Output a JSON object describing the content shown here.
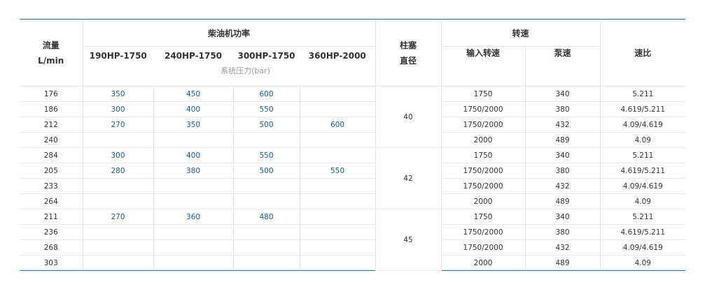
{
  "headers": {
    "flow_line1": "流量",
    "flow_line2": "L/min",
    "power_group": "柴油机功率",
    "power_cols": [
      "190HP-1750",
      "240HP-1750",
      "300HP-1750",
      "360HP-2000"
    ],
    "pressure_note": "系统压力(bar)",
    "plunger_line1": "柱塞",
    "plunger_line2": "直径",
    "speed_group": "转速",
    "input_speed": "输入转速",
    "pump_speed": "泵速",
    "ratio": "速比"
  },
  "rows": [
    {
      "flow": "176",
      "p1": "350",
      "p2": "450",
      "p3": "600",
      "p4": "",
      "input": "1750",
      "pump": "340",
      "ratio": "5.211"
    },
    {
      "flow": "186",
      "p1": "300",
      "p2": "400",
      "p3": "550",
      "p4": "",
      "input": "1750/2000",
      "pump": "380",
      "ratio": "4.619/5.211"
    },
    {
      "flow": "212",
      "p1": "270",
      "p2": "350",
      "p3": "500",
      "p4": "600",
      "input": "1750/2000",
      "pump": "432",
      "ratio": "4.09/4.619"
    },
    {
      "flow": "240",
      "p1": "",
      "p2": "",
      "p3": "",
      "p4": "",
      "input": "2000",
      "pump": "489",
      "ratio": "4.09"
    },
    {
      "flow": "284",
      "p1": "300",
      "p2": "400",
      "p3": "550",
      "p4": "",
      "input": "1750",
      "pump": "340",
      "ratio": "5.211"
    },
    {
      "flow": "205",
      "p1": "280",
      "p2": "380",
      "p3": "500",
      "p4": "550",
      "input": "1750/2000",
      "pump": "380",
      "ratio": "4.619/5.211"
    },
    {
      "flow": "233",
      "p1": "",
      "p2": "",
      "p3": "",
      "p4": "",
      "input": "1750/2000",
      "pump": "432",
      "ratio": "4.09/4.619"
    },
    {
      "flow": "264",
      "p1": "",
      "p2": "",
      "p3": "",
      "p4": "",
      "input": "2000",
      "pump": "489",
      "ratio": "4.09"
    },
    {
      "flow": "211",
      "p1": "270",
      "p2": "360",
      "p3": "480",
      "p4": "",
      "input": "1750",
      "pump": "340",
      "ratio": "5.211"
    },
    {
      "flow": "236",
      "p1": "",
      "p2": "",
      "p3": "",
      "p4": "",
      "input": "1750/2000",
      "pump": "380",
      "ratio": "4.619/5.211"
    },
    {
      "flow": "268",
      "p1": "",
      "p2": "",
      "p3": "",
      "p4": "",
      "input": "1750/2000",
      "pump": "432",
      "ratio": "4.09/4.619"
    },
    {
      "flow": "303",
      "p1": "",
      "p2": "",
      "p3": "",
      "p4": "",
      "input": "2000",
      "pump": "489",
      "ratio": "4.09"
    }
  ],
  "plunger_groups": [
    "40",
    "42",
    "45"
  ]
}
